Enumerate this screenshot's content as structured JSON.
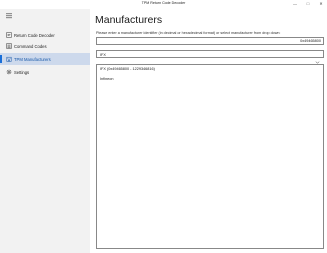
{
  "window": {
    "title": "TPM Return Code Decoder",
    "minimize": "—",
    "maximize": "□",
    "close": "✕"
  },
  "sidebar": {
    "menu_icon": "hamburger-icon",
    "items": [
      {
        "label": "Return Code Decoder",
        "icon": "decoder-icon",
        "selected": false
      },
      {
        "label": "Command Codes",
        "icon": "list-icon",
        "selected": false
      },
      {
        "label": "TPM Manufacturers",
        "icon": "building-icon",
        "selected": true
      },
      {
        "label": "Settings",
        "icon": "gear-icon",
        "selected": false
      }
    ]
  },
  "main": {
    "title": "Manufacturers",
    "instruction": "Please enter a manufacturer identifier (in decimal or hexadecimal format) or select manufacturer from drop down:",
    "identifier_value": "0x49465800",
    "selected_manufacturer": "IFX",
    "result_line1": "IFX (0x49465800 - 1229346816)",
    "result_line2": "Infineon"
  },
  "colors": {
    "sidebar_bg": "#f2f2f2",
    "selected_bg": "#cdd9ec",
    "accent": "#1a6fd8"
  }
}
